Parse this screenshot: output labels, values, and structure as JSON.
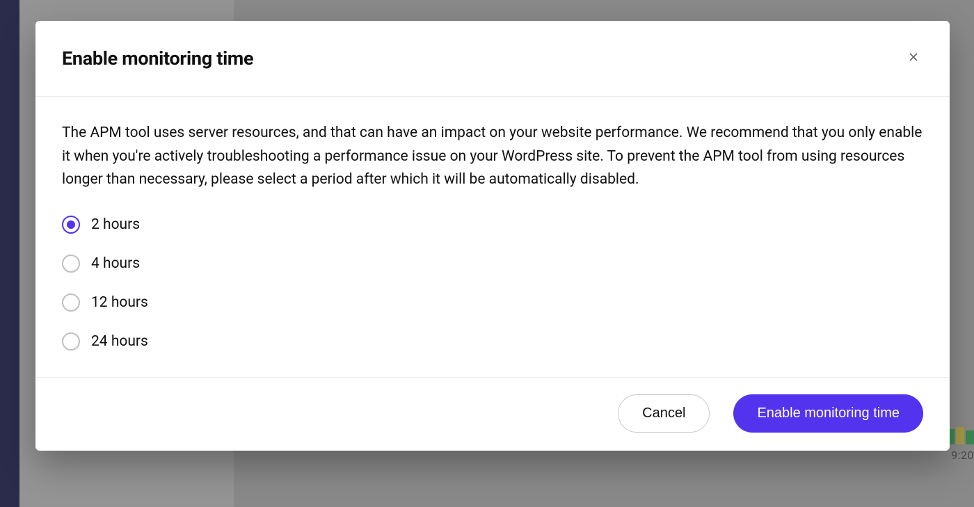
{
  "modal": {
    "title": "Enable monitoring time",
    "description": "The APM tool uses server resources, and that can have an impact on your website performance. We recommend that you only enable it when you're actively troubleshooting a performance issue on your WordPress site. To prevent the APM tool from using resources longer than necessary, please select a period after which it will be automatically disabled.",
    "options": [
      {
        "label": "2 hours",
        "selected": true
      },
      {
        "label": "4 hours",
        "selected": false
      },
      {
        "label": "12 hours",
        "selected": false
      },
      {
        "label": "24 hours",
        "selected": false
      }
    ],
    "footer": {
      "cancel_label": "Cancel",
      "confirm_label": "Enable monitoring time"
    }
  },
  "backdrop": {
    "timestamp": "9:20"
  }
}
